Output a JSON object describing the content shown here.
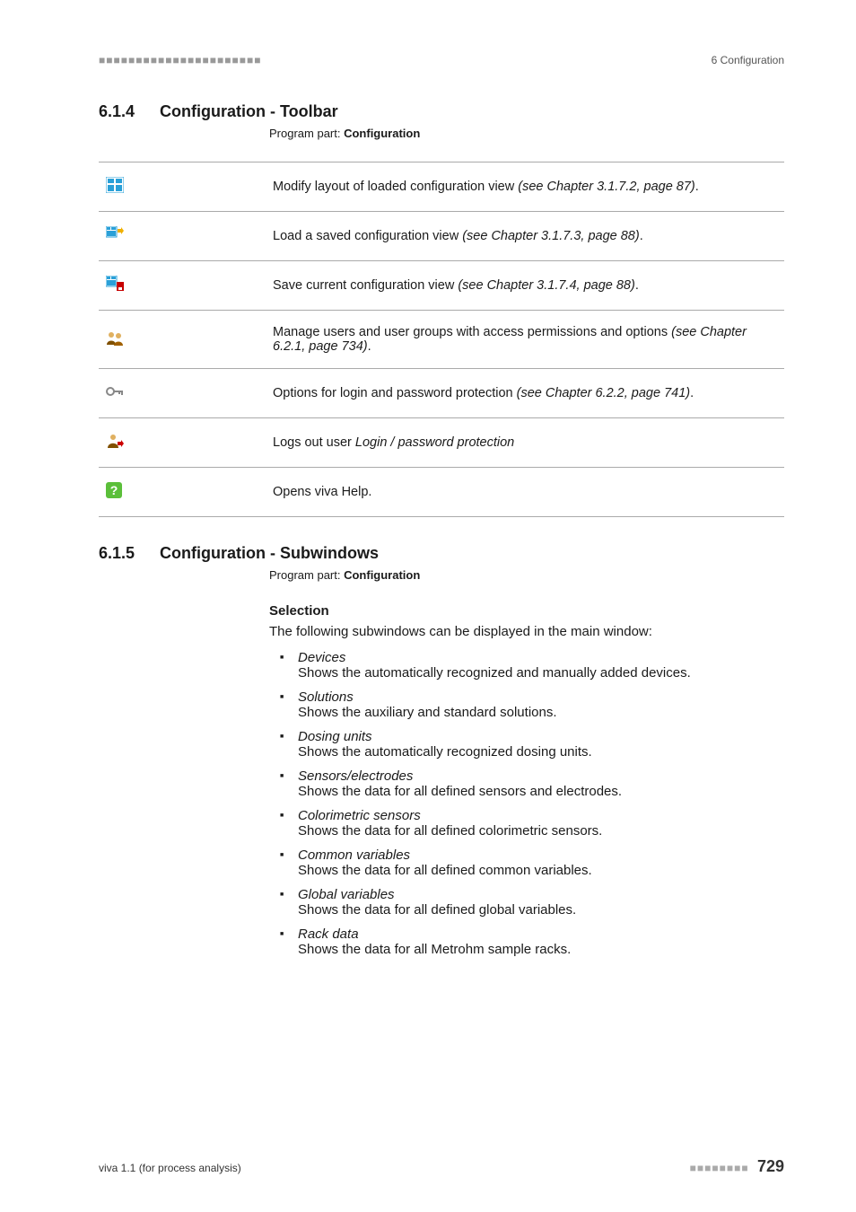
{
  "header": {
    "left_marks": "■■■■■■■■■■■■■■■■■■■■■■",
    "right": "6 Configuration"
  },
  "section614": {
    "number": "6.1.4",
    "title": "Configuration - Toolbar",
    "program_part_label": "Program part: ",
    "program_part_value": "Configuration"
  },
  "toolbar": [
    {
      "icon": "layout-icon",
      "desc_pre": "Modify layout of loaded configuration view ",
      "desc_em": "(see Chapter 3.1.7.2, page 87)",
      "desc_post": "."
    },
    {
      "icon": "load-view-icon",
      "desc_pre": "Load a saved configuration view ",
      "desc_em": "(see Chapter 3.1.7.3, page 88)",
      "desc_post": "."
    },
    {
      "icon": "save-view-icon",
      "desc_pre": "Save current configuration view ",
      "desc_em": "(see Chapter 3.1.7.4, page 88)",
      "desc_post": "."
    },
    {
      "icon": "users-icon",
      "desc_pre": "Manage users and user groups with access permissions and options ",
      "desc_em": "(see Chapter 6.2.1, page 734)",
      "desc_post": "."
    },
    {
      "icon": "key-icon",
      "desc_pre": "Options for login and password protection ",
      "desc_em": "(see Chapter 6.2.2, page 741)",
      "desc_post": "."
    },
    {
      "icon": "logout-icon",
      "desc_pre": "Logs out user ",
      "desc_em": "Login / password protection",
      "desc_post": ""
    },
    {
      "icon": "help-icon",
      "desc_pre": "Opens viva Help.",
      "desc_em": "",
      "desc_post": ""
    }
  ],
  "section615": {
    "number": "6.1.5",
    "title": "Configuration - Subwindows",
    "program_part_label": "Program part: ",
    "program_part_value": "Configuration",
    "selection_heading": "Selection",
    "selection_intro": "The following subwindows can be displayed in the main window:",
    "items": [
      {
        "term": "Devices",
        "desc": "Shows the automatically recognized and manually added devices."
      },
      {
        "term": "Solutions",
        "desc": "Shows the auxiliary and standard solutions."
      },
      {
        "term": "Dosing units",
        "desc": "Shows the automatically recognized dosing units."
      },
      {
        "term": "Sensors/electrodes",
        "desc": "Shows the data for all defined sensors and electrodes."
      },
      {
        "term": "Colorimetric sensors",
        "desc": "Shows the data for all defined colorimetric sensors."
      },
      {
        "term": "Common variables",
        "desc": "Shows the data for all defined common variables."
      },
      {
        "term": "Global variables",
        "desc": "Shows the data for all defined global variables."
      },
      {
        "term": "Rack data",
        "desc": "Shows the data for all Metrohm sample racks."
      }
    ]
  },
  "footer": {
    "left": "viva 1.1 (for process analysis)",
    "right_marks": "■■■■■■■■",
    "page": "729"
  }
}
